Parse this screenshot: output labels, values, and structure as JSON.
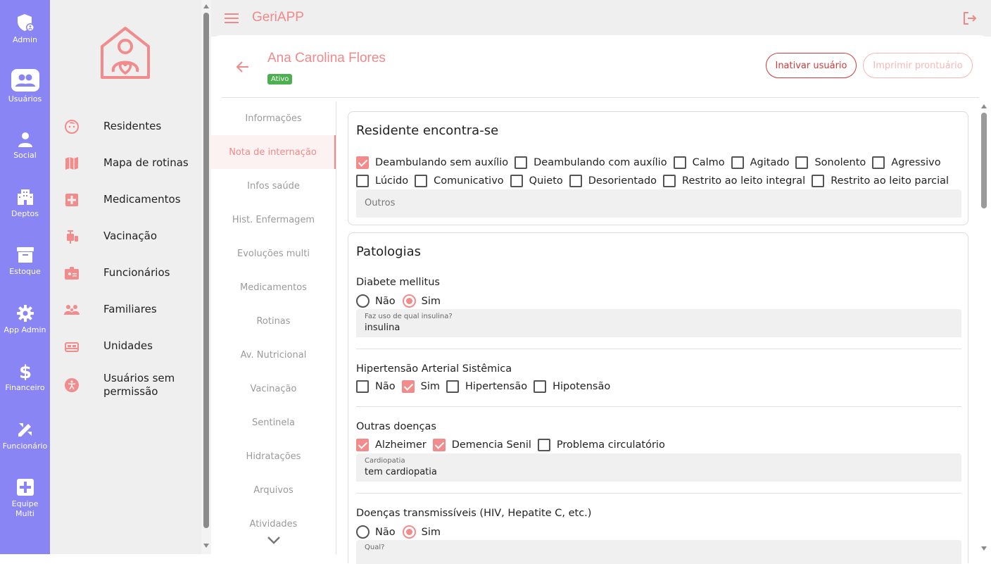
{
  "rail": [
    {
      "label": "Admin",
      "icon": "admin-shield-icon",
      "active": false
    },
    {
      "label": "Usuários",
      "icon": "users-icon",
      "active": true
    },
    {
      "label": "Social",
      "icon": "person-icon",
      "active": false
    },
    {
      "label": "Deptos",
      "icon": "building-icon",
      "active": false
    },
    {
      "label": "Estoque",
      "icon": "archive-icon",
      "active": false
    },
    {
      "label": "App Admin",
      "icon": "gear-icon",
      "active": false
    },
    {
      "label": "Financeiro",
      "icon": "dollar-icon",
      "active": false
    },
    {
      "label": "Funcionário",
      "icon": "pen-ruler-icon",
      "active": false
    },
    {
      "label": "Equipe Multi",
      "icon": "medical-plus-icon",
      "active": false
    }
  ],
  "sidebar": {
    "items": [
      {
        "label": "Residentes",
        "icon": "face-icon"
      },
      {
        "label": "Mapa de rotinas",
        "icon": "map-icon"
      },
      {
        "label": "Medicamentos",
        "icon": "medical-box-icon"
      },
      {
        "label": "Vacinação",
        "icon": "syringe-icon"
      },
      {
        "label": "Funcionários",
        "icon": "badge-icon"
      },
      {
        "label": "Familiares",
        "icon": "family-icon"
      },
      {
        "label": "Unidades",
        "icon": "bed-icon"
      },
      {
        "label": "Usuários sem permissão",
        "icon": "accessibility-icon"
      }
    ]
  },
  "topbar": {
    "title": "GeriAPP"
  },
  "header": {
    "name": "Ana Carolina Flores",
    "status": "Ativo",
    "deactivate_label": "Inativar usuário",
    "print_label": "Imprimir prontuário"
  },
  "tabs": [
    "Informações",
    "Nota de internação",
    "Infos saúde",
    "Hist. Enfermagem",
    "Evoluções multi",
    "Medicamentos",
    "Rotinas",
    "Av. Nutricional",
    "Vacinação",
    "Sentinela",
    "Hidratações",
    "Arquivos",
    "Atividades"
  ],
  "active_tab": "Nota de internação",
  "residente": {
    "title": "Residente encontra-se",
    "row1": [
      {
        "label": "Deambulando sem auxílio",
        "checked": true
      },
      {
        "label": "Deambulando com auxílio",
        "checked": false
      },
      {
        "label": "Calmo",
        "checked": false
      },
      {
        "label": "Agitado",
        "checked": false
      },
      {
        "label": "Sonolento",
        "checked": false
      },
      {
        "label": "Agressivo",
        "checked": false
      }
    ],
    "row2": [
      {
        "label": "Lúcido",
        "checked": false
      },
      {
        "label": "Comunicativo",
        "checked": false
      },
      {
        "label": "Quieto",
        "checked": false
      },
      {
        "label": "Desorientado",
        "checked": false
      },
      {
        "label": "Restrito ao leito integral",
        "checked": false
      },
      {
        "label": "Restrito ao leito parcial",
        "checked": false
      }
    ],
    "outros_placeholder": "Outros"
  },
  "patologias": {
    "title": "Patologias",
    "diabetes": {
      "question": "Diabete mellitus",
      "no": "Não",
      "yes": "Sim",
      "selected": "Sim",
      "field_label": "Faz uso de qual insulina?",
      "field_value": "insulina"
    },
    "hipertensao": {
      "question": "Hipertensão Arterial Sistêmica",
      "options": [
        {
          "label": "Não",
          "checked": false
        },
        {
          "label": "Sim",
          "checked": true
        },
        {
          "label": "Hipertensão",
          "checked": false
        },
        {
          "label": "Hipotensão",
          "checked": false
        }
      ]
    },
    "outras": {
      "question": "Outras doenças",
      "options": [
        {
          "label": "Alzheimer",
          "checked": true
        },
        {
          "label": "Demencia Senil",
          "checked": true
        },
        {
          "label": "Problema circulatório",
          "checked": false
        }
      ],
      "field_label": "Cardiopatia",
      "field_value": "tem cardiopatia"
    },
    "transmissiveis": {
      "question": "Doenças transmissíveis (HIV, Hepatite C, etc.)",
      "no": "Não",
      "yes": "Sim",
      "selected": "Sim",
      "field_label": "Qual?"
    }
  },
  "colors": {
    "rail": "#8a85f5",
    "accent": "#f08a8a",
    "badge": "#4caf50"
  }
}
